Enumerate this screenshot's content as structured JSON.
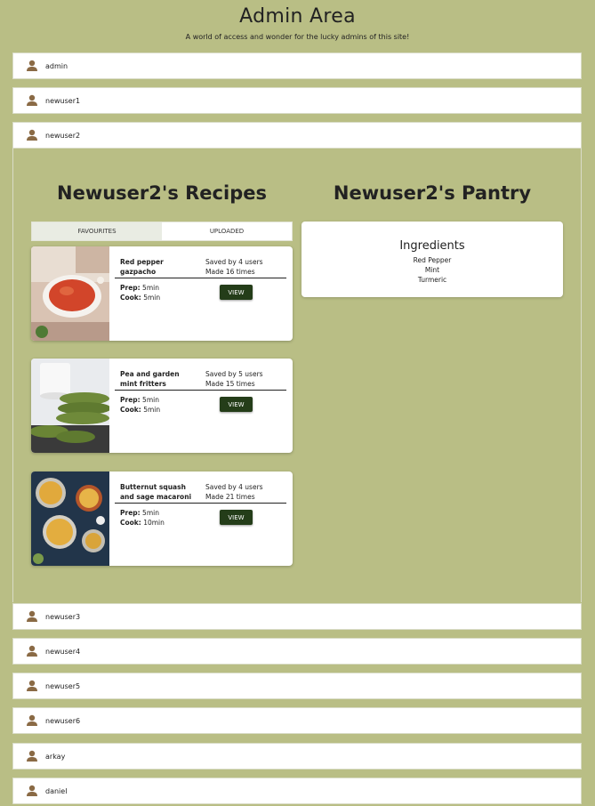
{
  "header": {
    "title": "Admin Area",
    "subtitle": "A world of access and wonder for the lucky admins of this site!"
  },
  "users_top": [
    {
      "name": "admin"
    },
    {
      "name": "newuser1"
    },
    {
      "name": "newuser2"
    }
  ],
  "expanded": {
    "recipes_title": "Newuser2's Recipes",
    "pantry_title": "Newuser2's Pantry",
    "tabs": [
      {
        "label": "FAVOURITES",
        "active": true
      },
      {
        "label": "UPLOADED",
        "active": false
      }
    ],
    "recipes": [
      {
        "name": "Red pepper gazpacho",
        "saved": "Saved by 4 users",
        "made": "Made 16 times",
        "prep_label": "Prep:",
        "prep": "5min",
        "cook_label": "Cook:",
        "cook": "5min",
        "button": "VIEW",
        "image": "gazpacho-bowl"
      },
      {
        "name": "Pea and garden mint fritters",
        "saved": "Saved by 5 users",
        "made": "Made 15 times",
        "prep_label": "Prep:",
        "prep": "5min",
        "cook_label": "Cook:",
        "cook": "5min",
        "button": "VIEW",
        "image": "fritters-stack"
      },
      {
        "name": "Butternut squash and sage macaroni",
        "saved": "Saved by 4 users",
        "made": "Made 21 times",
        "prep_label": "Prep:",
        "prep": "5min",
        "cook_label": "Cook:",
        "cook": "10min",
        "button": "VIEW",
        "image": "macaroni-bowls"
      }
    ],
    "pantry": {
      "heading": "Ingredients",
      "items": [
        "Red Pepper",
        "Mint",
        "Turmeric"
      ]
    }
  },
  "users_bottom": [
    {
      "name": "newuser3"
    },
    {
      "name": "newuser4"
    },
    {
      "name": "newuser5"
    },
    {
      "name": "newuser6"
    },
    {
      "name": "arkay"
    },
    {
      "name": "daniel"
    }
  ],
  "colors": {
    "background": "#b9be85",
    "button": "#243d19",
    "user_icon": "#8a6a45"
  },
  "icons": {
    "user": "person-icon"
  }
}
